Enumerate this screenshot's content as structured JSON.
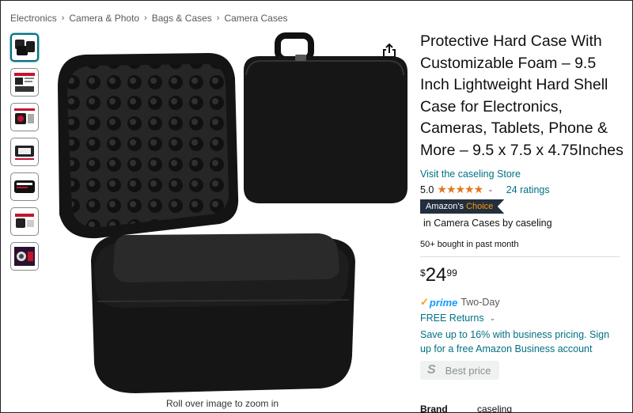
{
  "breadcrumb": [
    "Electronics",
    "Camera & Photo",
    "Bags & Cases",
    "Camera Cases"
  ],
  "breadcrumb_separator": "›",
  "gallery": {
    "thumbnails": [
      "product-image-1",
      "product-image-2",
      "product-image-3",
      "product-image-4",
      "product-image-5",
      "product-image-6",
      "product-image-7"
    ],
    "active_index": 0,
    "zoom_hint": "Roll over image to zoom in"
  },
  "product": {
    "title": "Protective Hard Case With Customizable Foam – 9.5 Inch Lightweight Hard Shell Case for Electronics, Cameras, Tablets, Phone & More – 9.5 x 7.5 x 4.75Inches",
    "store_link": "Visit the caseling Store",
    "rating": "5.0",
    "stars": "★★★★★",
    "ratings_count": "24 ratings",
    "choice_badge_prefix": "Amazon's",
    "choice_badge_accent": "Choice",
    "choice_line": "in Camera Cases by caseling",
    "bought": "50+ bought in past month",
    "price": {
      "symbol": "$",
      "whole": "24",
      "fraction": "99"
    },
    "prime_label": "prime",
    "prime_extra": "Two-Day",
    "returns": "FREE Returns",
    "business_offer": "Save up to 16% with business pricing. Sign up for a free Amazon Business account",
    "best_price_label": "Best price",
    "brand_label": "Brand",
    "brand_value": "caseling"
  },
  "icons": {
    "share": "share-icon",
    "chevron": "chevron-down-icon",
    "prime_check": "check-icon"
  },
  "colors": {
    "link": "#007185",
    "star": "#de7921",
    "badge_bg": "#232f3e",
    "badge_accent": "#ff9900",
    "prime": "#1399ff"
  }
}
